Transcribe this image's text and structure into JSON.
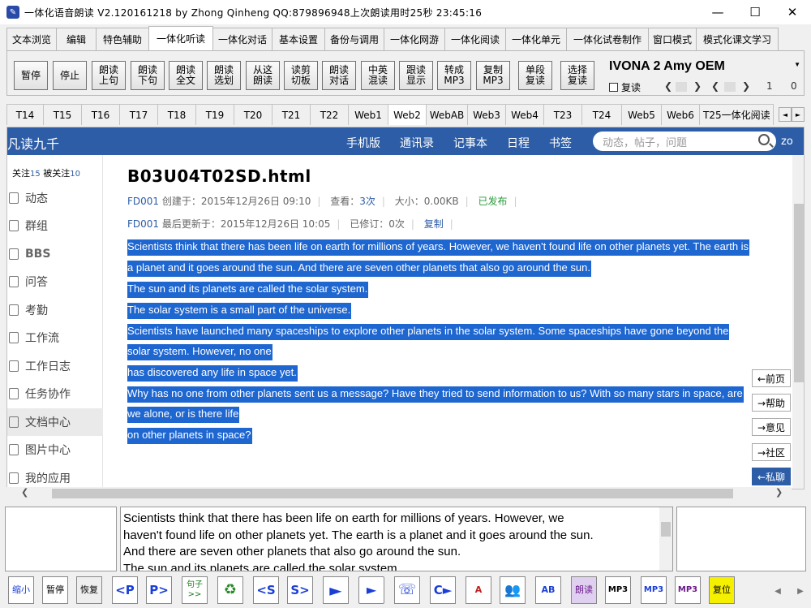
{
  "titlebar": {
    "title": "一体化语音朗读 V2.120161218 by Zhong Qinheng QQ:879896948上次朗读用时25秒   23:45:16",
    "minimize": "—",
    "maximize": "☐",
    "close": "✕"
  },
  "menu_tabs": [
    "文本浏览",
    "编辑",
    "特色辅助",
    "一体化听读",
    "一体化对话",
    "基本设置",
    "备份与调用",
    "一体化网游",
    "一体化阅读",
    "一体化单元",
    "一体化试卷制作",
    "窗口模式",
    "模式化课文学习"
  ],
  "toolbar": {
    "buttons": [
      {
        "l1": "暂停",
        "l2": ""
      },
      {
        "l1": "停止",
        "l2": ""
      },
      {
        "l1": "朗读",
        "l2": "上句"
      },
      {
        "l1": "朗读",
        "l2": "下句"
      },
      {
        "l1": "朗读",
        "l2": "全文"
      },
      {
        "l1": "朗读",
        "l2": "选划"
      },
      {
        "l1": "从这",
        "l2": "朗读"
      },
      {
        "l1": "读剪",
        "l2": "切板"
      },
      {
        "l1": "朗读",
        "l2": "对话"
      },
      {
        "l1": "中英",
        "l2": "混读"
      },
      {
        "l1": "跟读",
        "l2": "显示"
      },
      {
        "l1": "转成",
        "l2": "MP3"
      },
      {
        "l1": "复制",
        "l2": "MP3"
      },
      {
        "l1": "单段",
        "l2": "复读"
      },
      {
        "l1": "选择",
        "l2": "复读"
      }
    ],
    "voice": "IVONA 2 Amy OEM",
    "repeat_label": "复读",
    "counter1": "1",
    "counter2": "0"
  },
  "page_tabs": [
    "T14",
    "T15",
    "T16",
    "T17",
    "T18",
    "T19",
    "T20",
    "T21",
    "T22",
    "Web1",
    "Web2",
    "WebAB",
    "Web3",
    "Web4",
    "T23",
    "T24",
    "Web5",
    "Web6",
    "T25一体化阅读"
  ],
  "web": {
    "brand": "凡读九千",
    "nav": [
      "手机版",
      "通讯录",
      "记事本",
      "日程",
      "书签"
    ],
    "search_placeholder": "动态，帖子，问题",
    "user_short": "zo",
    "follow_label": "关注",
    "follow_count": "15",
    "followers_label": "被关注",
    "followers_count": "10",
    "sidebar": [
      "动态",
      "群组",
      "BBS",
      "问答",
      "考勤",
      "工作流",
      "工作日志",
      "任务协作",
      "文档中心",
      "图片中心",
      "我的应用"
    ],
    "doc_title": "B03U04T02SD.html",
    "meta1": {
      "author": "FD001",
      "created": "创建于：2015年12月26日 09:10",
      "views_label": "查看：",
      "views": "3次",
      "size": "大小：0.00KB",
      "status": "已发布"
    },
    "meta2": {
      "author": "FD001",
      "updated": "最后更新于：2015年12月26日 10:05",
      "revised": "已修订：0次",
      "copy": "复制"
    },
    "lines": [
      "Scientists think that there has been life on earth for millions of years. However, we haven't found life on other planets yet. The earth is",
      "a planet and it goes around the sun. And there are seven other planets that also go around the sun.",
      "The sun and its planets are called the solar system.",
      "The solar system is a small part of the universe.",
      "Scientists have launched many spaceships to explore other planets in the solar system. Some spaceships have gone beyond the",
      "solar system. However, no one",
      "has discovered any life in space yet.",
      "Why has no one from other planets sent us a message? Have they tried to send information to us? With so many stars in space, are",
      "we alone, or is there life",
      "on other planets in space?"
    ],
    "side_buttons": [
      "←前页",
      "→帮助",
      "→意见",
      "→社区",
      "←私聊"
    ]
  },
  "textarea_lines": [
    "Scientists think that there has been life on earth for millions of years. However, we",
    "haven't found life on other planets yet. The earth is a planet and it goes around the sun.",
    "And there are seven other planets that also go around the sun.",
    "The sun and its planets are called the solar system."
  ],
  "bottom_buttons": [
    {
      "label": "缩小",
      "icon": "zoom-icon"
    },
    {
      "label": "暂停",
      "icon": "pause-icon"
    },
    {
      "label": "恢复",
      "icon": "resume-icon"
    },
    {
      "label": "<P",
      "icon": "prev-paragraph-icon"
    },
    {
      "label": "P>",
      "icon": "next-paragraph-icon"
    },
    {
      "label": "句子>>",
      "icon": "sentence-icon"
    },
    {
      "label": "♻",
      "icon": "recycle-icon"
    },
    {
      "label": "<S",
      "icon": "prev-sentence-icon"
    },
    {
      "label": "S>",
      "icon": "next-sentence-icon"
    },
    {
      "label": "►",
      "icon": "play-icon"
    },
    {
      "label": "►",
      "icon": "play-circle-icon"
    },
    {
      "label": "☏",
      "icon": "speaker-icon"
    },
    {
      "label": "C►",
      "icon": "c-play-icon"
    },
    {
      "label": "A",
      "icon": "people-a-icon"
    },
    {
      "label": "👥",
      "icon": "people-icon"
    },
    {
      "label": "AB",
      "icon": "people-ab-icon"
    },
    {
      "label": "朗读",
      "icon": "read-icon"
    },
    {
      "label": "MP3",
      "icon": "mp3-icon"
    },
    {
      "label": "MP3",
      "icon": "mp3-disc-icon"
    },
    {
      "label": "MP3",
      "icon": "mp3-record-icon"
    },
    {
      "label": "复位",
      "icon": "reset-icon"
    }
  ]
}
